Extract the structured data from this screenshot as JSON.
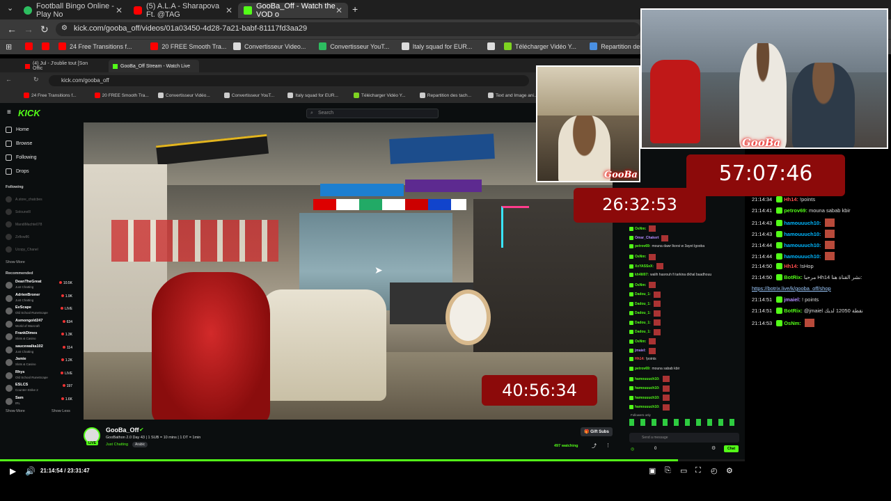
{
  "browser": {
    "tabs": [
      {
        "title": "Football Bingo Online - Play No",
        "favicon_color": "#2dbe60"
      },
      {
        "title": "(5) A.L.A - Sharapova Ft. @TAG",
        "favicon_color": "#ff0000"
      },
      {
        "title": "GooBa_Off - Watch the VOD o",
        "favicon_color": "#53fc18"
      }
    ],
    "new_tab": "+",
    "tab_close": "✕",
    "url": "kick.com/gooba_off/videos/01a03450-4d28-7a21-babf-81117fd3aa29",
    "bookmarks": [
      {
        "label": "",
        "color": "#ff0000"
      },
      {
        "label": "",
        "color": "#ff0000"
      },
      {
        "label": "24 Free Transitions f...",
        "color": "#ff0000"
      },
      {
        "label": "20 FREE Smooth Tra...",
        "color": "#ff0000"
      },
      {
        "label": "Convertisseur Video...",
        "color": "#dddddd"
      },
      {
        "label": "Convertisseur YouT...",
        "color": "#2dbe60"
      },
      {
        "label": "Italy squad for EUR...",
        "color": "#dddddd"
      },
      {
        "label": "",
        "color": "#dddddd"
      },
      {
        "label": "Télécharger Vidéo Y...",
        "color": "#7ed321"
      },
      {
        "label": "Repartition des tach...",
        "color": "#4a90e2"
      },
      {
        "label": "Text and Image ani...",
        "color": "#ff0000"
      }
    ]
  },
  "inner_browser": {
    "tabs": [
      "(4) Jul - J'oublie tout [Son Offic",
      "GooBa_Off Stream - Watch Live"
    ],
    "url": "kick.com/gooba_off",
    "bookmarks": [
      "24 Free Transitions f...",
      "20 FREE Smooth Tra...",
      "Convertisseur Vidéo...",
      "Convertisseur YouT...",
      "Italy squad for EUR...",
      "Télécharger Vidéo Y...",
      "Repartition des tach...",
      "Text and Image ani..."
    ]
  },
  "kick": {
    "logo": "KICK",
    "search_placeholder": "Search",
    "nav": [
      "Home",
      "Browse",
      "Following",
      "Drops"
    ],
    "following_head": "Following",
    "following": [
      "A.store_chatcbes",
      "Solounelll",
      "MandiMachte078",
      "Zxflow86",
      "Ucopy_Chanel"
    ],
    "show_more": "Show More",
    "recommended_head": "Recommended",
    "recommended": [
      {
        "name": "DeanTheGreat",
        "cat": "Just Chatting",
        "viewers": "10.5K"
      },
      {
        "name": "AdrienBroner",
        "cat": "Just Chatting",
        "viewers": "1.9K"
      },
      {
        "name": "EvScape",
        "cat": "Old School RuneScape",
        "viewers": "LIVE"
      },
      {
        "name": "Asmongold247",
        "cat": "World of Warcraft",
        "viewers": "634"
      },
      {
        "name": "FrankDimes",
        "cat": "Slots & Casino",
        "viewers": "1.3K"
      },
      {
        "name": "saucewalka102",
        "cat": "Just Chatting",
        "viewers": "114"
      },
      {
        "name": "Jamie",
        "cat": "Slots & Casino",
        "viewers": "1.2K"
      },
      {
        "name": "Rhys",
        "cat": "Old School RuneScape",
        "viewers": "LIVE"
      },
      {
        "name": "ESLCS",
        "cat": "Counter-Strike 2",
        "viewers": "197"
      },
      {
        "name": "Sam",
        "cat": "IRL",
        "viewers": "1.6K"
      }
    ],
    "show_more_2": "Show More",
    "show_less": "Show Less"
  },
  "stream": {
    "timer_video": "40:56:34",
    "channel": "GooBa_Off",
    "title": "GooBathon 2.0 Day 43 | 1 SUB = 10 mins | 1 DT = 1min",
    "category": "Just Chatting",
    "language": "Arabic",
    "live": "LIVE",
    "gift_subs": "Gift Subs",
    "watching": "497 watching"
  },
  "overlay": {
    "gooba_text": "GooBa",
    "timer_small": "26:32:53",
    "timer_big": "57:07:46"
  },
  "inner_chat": [
    {
      "user": "OsNm:",
      "color": "#53fc18",
      "msg": ""
    },
    {
      "user": "Omar_Chakert",
      "color": "#b38cff",
      "msg": ""
    },
    {
      "user": "petrov69:",
      "color": "#53fc18",
      "msg": "mouna dawr lkorsi w 3ayet lgooba"
    },
    {
      "user": "OsNm:",
      "color": "#53fc18",
      "msg": ""
    },
    {
      "user": "XxYASSxX:",
      "color": "#53fc18",
      "msg": ""
    },
    {
      "user": "kh4lil07:",
      "color": "#53fc18",
      "msg": "walih hasrouh fi tarkina dkhal baadhouu"
    },
    {
      "user": "OsNm:",
      "color": "#53fc18",
      "msg": ""
    },
    {
      "user": "Dadou_1:",
      "color": "#53fc18",
      "msg": ""
    },
    {
      "user": "Dadou_1:",
      "color": "#53fc18",
      "msg": ""
    },
    {
      "user": "Dadou_1:",
      "color": "#53fc18",
      "msg": ""
    },
    {
      "user": "Dadou_1:",
      "color": "#53fc18",
      "msg": ""
    },
    {
      "user": "Dadou_1:",
      "color": "#53fc18",
      "msg": ""
    },
    {
      "user": "OsNm:",
      "color": "#53fc18",
      "msg": ""
    },
    {
      "user": "jmaiel:",
      "color": "#b38cff",
      "msg": ""
    },
    {
      "user": "Hh14:",
      "color": "#ff4d4d",
      "msg": "!points"
    },
    {
      "user": "petrov69:",
      "color": "#53fc18",
      "msg": "mouna sabab kbir"
    },
    {
      "user": "hamouuuch10:",
      "color": "#53fc18",
      "msg": ""
    },
    {
      "user": "hamouuuch10:",
      "color": "#53fc18",
      "msg": ""
    },
    {
      "user": "hamouuuch10:",
      "color": "#53fc18",
      "msg": ""
    },
    {
      "user": "hamouuuch10:",
      "color": "#53fc18",
      "msg": ""
    }
  ],
  "chat_footer": {
    "followers_only": "Followers only",
    "placeholder": "Send a message",
    "points": "0",
    "chat_button": "Chat"
  },
  "right_chat": [
    {
      "ts": "21:14:34",
      "user": "Hh14:",
      "color": "#ff4d4d",
      "msg": "!points",
      "emote": false
    },
    {
      "ts": "21:14:41",
      "user": "petrov69:",
      "color": "#53fc18",
      "msg": "mouna sabab kbir",
      "emote": false
    },
    {
      "ts": "21:14:43",
      "user": "hamouuuch10:",
      "color": "#00b7ff",
      "msg": "",
      "emote": true
    },
    {
      "ts": "21:14:43",
      "user": "hamouuuch10:",
      "color": "#00b7ff",
      "msg": "",
      "emote": true
    },
    {
      "ts": "21:14:44",
      "user": "hamouuuch10:",
      "color": "#00b7ff",
      "msg": "",
      "emote": true
    },
    {
      "ts": "21:14:44",
      "user": "hamouuuch10:",
      "color": "#00b7ff",
      "msg": "",
      "emote": true
    },
    {
      "ts": "21:14:50",
      "user": "Hh14:",
      "color": "#ff4d4d",
      "msg": "!sHop",
      "emote": false
    },
    {
      "ts": "21:14:50",
      "user": "BotRix:",
      "color": "#53fc18",
      "msg": "مرحبا Hh14 نشر القناة هنا:",
      "emote": false
    },
    {
      "ts": "",
      "user": "",
      "color": "#9ecbff",
      "msg": "https://botrix.live/k/gooba_off/shop",
      "emote": false
    },
    {
      "ts": "21:14:51",
      "user": "jmaiel:",
      "color": "#b38cff",
      "msg": "! points",
      "emote": false
    },
    {
      "ts": "21:14:51",
      "user": "BotRix:",
      "color": "#53fc18",
      "msg": "@jmaiel نقطة 12050 لديك",
      "emote": false
    },
    {
      "ts": "21:14:53",
      "user": "OsNm:",
      "color": "#53fc18",
      "msg": "",
      "emote": true
    }
  ],
  "player": {
    "time": "21:14:54 / 23:31:47",
    "progress_fraction": 0.91
  }
}
